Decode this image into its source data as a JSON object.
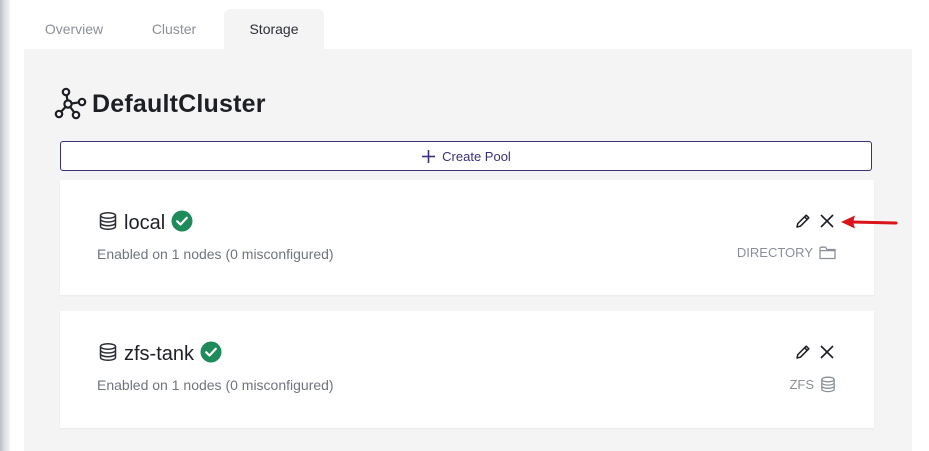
{
  "tabs": [
    {
      "label": "Overview",
      "active": false
    },
    {
      "label": "Cluster",
      "active": false
    },
    {
      "label": "Storage",
      "active": true
    }
  ],
  "cluster": {
    "name": "DefaultCluster",
    "icon": "cluster-graph-icon"
  },
  "create_pool": {
    "label": "Create Pool",
    "icon": "plus-icon"
  },
  "pools": [
    {
      "name": "local",
      "status": "healthy",
      "status_color": "#1f8a5a",
      "summary": "Enabled on 1 nodes (0 misconfigured)",
      "driver": "DIRECTORY",
      "driver_icon": "folder-icon"
    },
    {
      "name": "zfs-tank",
      "status": "healthy",
      "status_color": "#1f8a5a",
      "summary": "Enabled on 1 nodes (0 misconfigured)",
      "driver": "ZFS",
      "driver_icon": "database-icon"
    }
  ],
  "colors": {
    "accent": "#3b2f7a",
    "success": "#1f8a5a",
    "annotation_arrow": "#d9141b"
  }
}
